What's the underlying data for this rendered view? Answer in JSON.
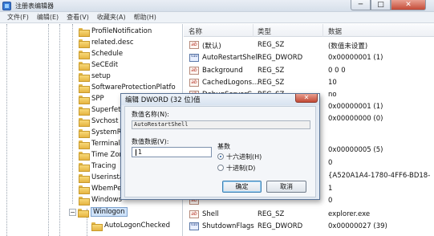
{
  "window": {
    "title": "注册表编辑器",
    "min_glyph": "─",
    "max_glyph": "□",
    "close_glyph": "✕"
  },
  "menu": [
    "文件(F)",
    "编辑(E)",
    "查看(V)",
    "收藏夹(A)",
    "帮助(H)"
  ],
  "tree": {
    "items": [
      {
        "label": "ProfileNotification"
      },
      {
        "label": "related.desc"
      },
      {
        "label": "Schedule"
      },
      {
        "label": "SeCEdit"
      },
      {
        "label": "setup"
      },
      {
        "label": "SoftwareProtectionPlatfo"
      },
      {
        "label": "SPP"
      },
      {
        "label": "Superfetch"
      },
      {
        "label": "Svchost"
      },
      {
        "label": "SystemRestore"
      },
      {
        "label": "Terminal Server"
      },
      {
        "label": "Time Zones"
      },
      {
        "label": "Tracing"
      },
      {
        "label": "Userinstallable"
      },
      {
        "label": "WbemPerf"
      },
      {
        "label": "Windows"
      },
      {
        "label": "Winlogon",
        "selected": true
      },
      {
        "label": "AutoLogonChecked"
      }
    ]
  },
  "list": {
    "columns": [
      "名称",
      "类型",
      "数据"
    ],
    "rows": [
      {
        "icon": "ab",
        "name": "(默认)",
        "type": "REG_SZ",
        "data": "(数值未设置)"
      },
      {
        "icon": "bin",
        "name": "AutoRestartShell",
        "type": "REG_DWORD",
        "data": "0x00000001 (1)"
      },
      {
        "icon": "ab",
        "name": "Background",
        "type": "REG_SZ",
        "data": "0 0 0"
      },
      {
        "icon": "ab",
        "name": "CachedLogons...",
        "type": "REG_SZ",
        "data": "10"
      },
      {
        "icon": "ab",
        "name": "DebugServerC...",
        "type": "REG_SZ",
        "data": "no"
      },
      {
        "icon": "bin",
        "name": "",
        "type": "",
        "data": "0x00000001 (1)"
      },
      {
        "icon": "bin",
        "name": "",
        "type": "",
        "data": "0x00000000 (0)"
      },
      {
        "icon": "",
        "name": "",
        "type": "",
        "data": ""
      },
      {
        "icon": "",
        "name": "",
        "type": "",
        "data": ""
      },
      {
        "icon": "bin",
        "name": "",
        "type": "",
        "data": "0x00000005 (5)"
      },
      {
        "icon": "ab",
        "name": "",
        "type": "",
        "data": "0"
      },
      {
        "icon": "ab",
        "name": "",
        "type": "",
        "data": "{A520A1A4-1780-4FF6-BD18-"
      },
      {
        "icon": "ab",
        "name": "",
        "type": "",
        "data": "1"
      },
      {
        "icon": "ab",
        "name": "",
        "type": "",
        "data": "0"
      },
      {
        "icon": "ab",
        "name": "",
        "type": "",
        "data": ""
      },
      {
        "icon": "ab",
        "name": "Shell",
        "type": "REG_SZ",
        "data": "explorer.exe"
      },
      {
        "icon": "bin",
        "name": "ShutdownFlags",
        "type": "REG_DWORD",
        "data": "0x00000027 (39)"
      }
    ]
  },
  "dialog": {
    "title": "编辑 DWORD (32 位)值",
    "close_glyph": "✕",
    "name_label": "数值名称(N):",
    "name_value": "AutoRestartShell",
    "data_label": "数值数据(V):",
    "data_value": "1",
    "base_label": "基数",
    "radio_hex": "十六进制(H)",
    "radio_dec": "十进制(D)",
    "ok": "确定",
    "cancel": "取消"
  },
  "icons": {
    "string_value": "ab",
    "dword_value": "010"
  }
}
